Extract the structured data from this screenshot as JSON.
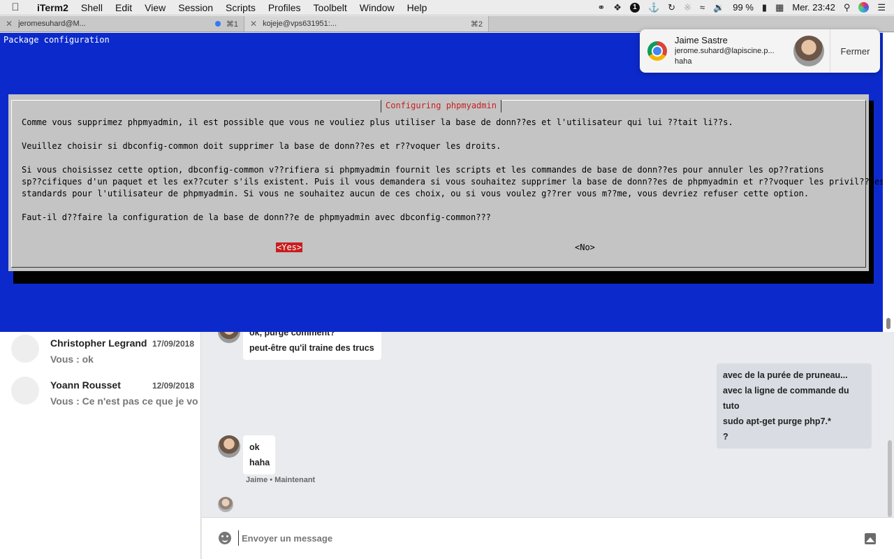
{
  "menubar": {
    "app": "iTerm2",
    "items": [
      "Shell",
      "Edit",
      "View",
      "Session",
      "Scripts",
      "Profiles",
      "Toolbelt",
      "Window",
      "Help"
    ],
    "notification_count": "1",
    "battery": "99 %",
    "clock": "Mer. 23:42"
  },
  "tabs": [
    {
      "title": "jeromesuhard@M...",
      "shortcut": "⌘1"
    },
    {
      "title": "kojeje@vps631951:...",
      "shortcut": "⌘2"
    }
  ],
  "terminal": {
    "title": "Package configuration",
    "dialog": {
      "caption": "Configuring phpmyadmin",
      "lines": [
        "Comme vous supprimez phpmyadmin, il est possible que vous ne vouliez plus utiliser la base de donn??es et l'utilisateur qui lui ??tait li??s.",
        "Veuillez choisir si dbconfig-common doit supprimer la base de donn??es et r??voquer les droits.",
        "Si vous choisissez cette option, dbconfig-common v??rifiera si phpmyadmin fournit les scripts et les commandes de base de donn??es pour annuler les op??rations",
        "sp??cifiques d'un paquet et les ex??cuter s'ils existent. Puis il vous demandera si vous souhaitez supprimer la base de donn??es de phpmyadmin et r??voquer les privil??ges",
        "standards pour l'utilisateur de phpmyadmin. Si vous ne souhaitez aucun de ces choix, ou si vous voulez g??rer vous m??me, vous devriez refuser cette option.",
        "Faut-il d??faire la configuration de la base de donn??e de phpmyadmin avec dbconfig-common???"
      ],
      "yes": "<Yes>",
      "no": "<No>"
    }
  },
  "notification": {
    "sender": "Jaime Sastre",
    "email": "jerome.suhard@lapiscine.p...",
    "message": "haha",
    "close": "Fermer"
  },
  "conversations": [
    {
      "name": "Christopher Legrand",
      "date": "17/09/2018",
      "preview": "Vous : ok"
    },
    {
      "name": "Yoann Rousset",
      "date": "12/09/2018",
      "preview": "Vous : Ce n'est pas ce que je voul"
    }
  ],
  "chat": {
    "top_partial": "ok, purge comment?",
    "top_line": "peut-être qu'il traine des trucs",
    "mine": [
      "avec de la purée de pruneau...",
      "avec la ligne de commande du tuto",
      "sudo apt-get purge php7.*",
      "?"
    ],
    "theirs": [
      "ok",
      "haha"
    ],
    "meta": "Jaime • Maintenant"
  },
  "composer": {
    "placeholder": "Envoyer un message"
  }
}
